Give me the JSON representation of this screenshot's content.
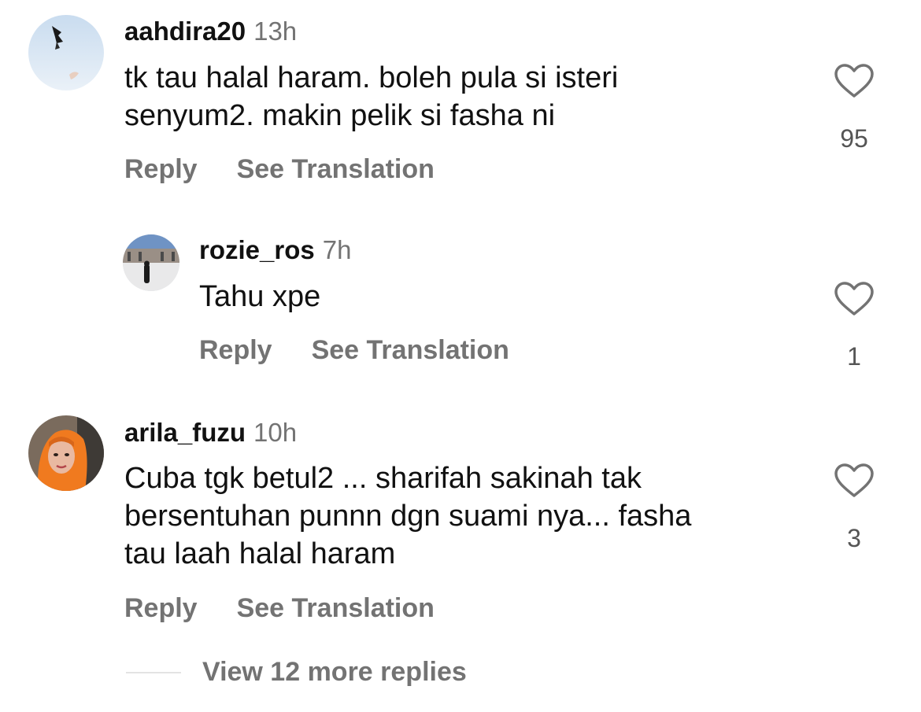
{
  "comments": [
    {
      "username": "aahdira20",
      "time": "13h",
      "text_lines": [
        "tk tau halal haram. boleh pula si isteri",
        "senyum2. makin pelik si fasha ni"
      ],
      "reply_label": "Reply",
      "translate_label": "See Translation",
      "likes": "95",
      "avatar_icon": "avatar-sky-figure"
    },
    {
      "username": "rozie_ros",
      "time": "7h",
      "text_lines": [
        "Tahu xpe"
      ],
      "reply_label": "Reply",
      "translate_label": "See Translation",
      "likes": "1",
      "avatar_icon": "avatar-mosque-courtyard"
    },
    {
      "username": "arila_fuzu",
      "time": "10h",
      "text_lines": [
        "Cuba tgk betul2 ... sharifah sakinah tak",
        "bersentuhan punnn dgn suami nya... fasha",
        "tau laah halal haram"
      ],
      "reply_label": "Reply",
      "translate_label": "See Translation",
      "likes": "3",
      "avatar_icon": "avatar-woman-orange-hijab"
    }
  ],
  "view_more_replies": "View 12 more replies",
  "colors": {
    "primary_text": "#111111",
    "secondary_text": "#737373",
    "divider": "#e3e3e3",
    "heart_outline": "#737373"
  }
}
